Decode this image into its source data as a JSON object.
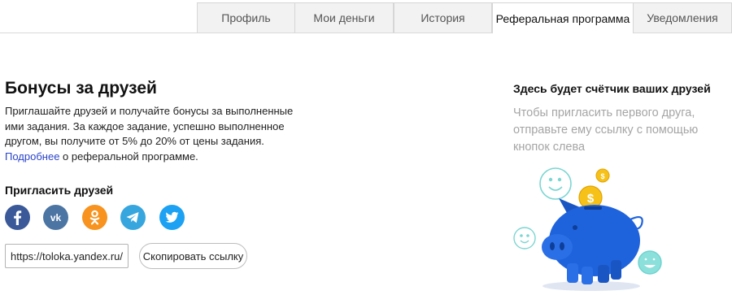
{
  "tabs": [
    {
      "label": "Профиль",
      "active": false
    },
    {
      "label": "Мои деньги",
      "active": false
    },
    {
      "label": "История",
      "active": false
    },
    {
      "label": "Реферальная программа",
      "active": true
    },
    {
      "label": "Уведомления",
      "active": false
    }
  ],
  "bonus": {
    "title": "Бонусы за друзей",
    "description": "Приглашайте друзей и получайте бонусы за выполненные ими задания. За каждое задание, успешно выполненное другом, вы получите от 5% до 20% от цены задания.",
    "more_link": "Подробнее",
    "description_tail": "о реферальной программе."
  },
  "invite": {
    "title": "Пригласить друзей",
    "socials": [
      {
        "name": "facebook",
        "icon": "facebook-icon",
        "color": "#3b5998"
      },
      {
        "name": "vk",
        "icon": "vk-icon",
        "color": "#4c75a3"
      },
      {
        "name": "odnoklassniki",
        "icon": "odnoklassniki-icon",
        "color": "#f7931e"
      },
      {
        "name": "telegram",
        "icon": "telegram-icon",
        "color": "#38a6de"
      },
      {
        "name": "twitter",
        "icon": "twitter-icon",
        "color": "#1da1f2"
      }
    ],
    "link_value": "https://toloka.yandex.ru/pi",
    "copy_label": "Скопировать ссылку"
  },
  "counter": {
    "title": "Здесь будет счётчик ваших друзей",
    "hint": "Чтобы пригласить первого друга, отправьте ему ссылку с помощью кнопок слева"
  },
  "colors": {
    "accent_link": "#2a44c8",
    "piggy_blue": "#1f63dc",
    "coin_gold": "#f6c21a",
    "smiley_teal": "#6ed3cf"
  }
}
